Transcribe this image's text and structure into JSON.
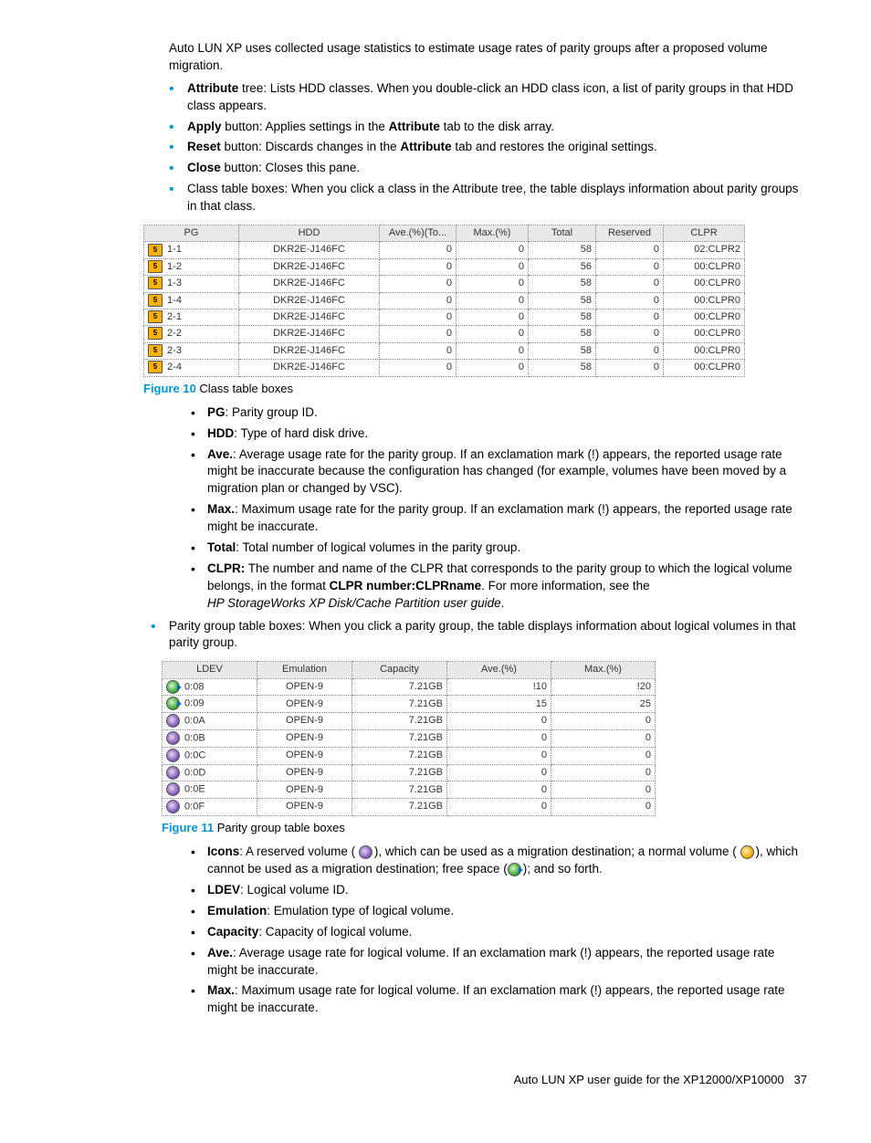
{
  "intro": "Auto LUN XP uses collected usage statistics to estimate usage rates of parity groups after a proposed volume migration.",
  "bullets1": [
    {
      "b": "Attribute",
      "post": " tree: Lists HDD classes. When you double-click an HDD class icon, a list of parity groups in that HDD class appears."
    },
    {
      "b": "Apply",
      "post": " button: Applies settings in the ",
      "b2": "Attribute",
      "post2": " tab to the disk array."
    },
    {
      "b": "Reset",
      "post": " button: Discards changes in the ",
      "b2": "Attribute",
      "post2": " tab and restores the original settings."
    },
    {
      "b": "Close",
      "post": " button: Closes this pane."
    },
    {
      "plain": "Class table boxes: When you click a class in the Attribute tree, the table displays information about parity groups in that class."
    }
  ],
  "table1": {
    "headers": [
      "PG",
      "HDD",
      "Ave.(%)(To...",
      "Max.(%)",
      "Total",
      "Reserved",
      "CLPR"
    ],
    "widths": [
      95,
      145,
      75,
      70,
      65,
      65,
      80
    ],
    "rows": [
      [
        "1-1",
        "DKR2E-J146FC",
        "0",
        "0",
        "58",
        "0",
        "02:CLPR2"
      ],
      [
        "1-2",
        "DKR2E-J146FC",
        "0",
        "0",
        "56",
        "0",
        "00:CLPR0"
      ],
      [
        "1-3",
        "DKR2E-J146FC",
        "0",
        "0",
        "58",
        "0",
        "00:CLPR0"
      ],
      [
        "1-4",
        "DKR2E-J146FC",
        "0",
        "0",
        "58",
        "0",
        "00:CLPR0"
      ],
      [
        "2-1",
        "DKR2E-J146FC",
        "0",
        "0",
        "58",
        "0",
        "00:CLPR0"
      ],
      [
        "2-2",
        "DKR2E-J146FC",
        "0",
        "0",
        "58",
        "0",
        "00:CLPR0"
      ],
      [
        "2-3",
        "DKR2E-J146FC",
        "0",
        "0",
        "58",
        "0",
        "00:CLPR0"
      ],
      [
        "2-4",
        "DKR2E-J146FC",
        "0",
        "0",
        "58",
        "0",
        "00:CLPR0"
      ]
    ]
  },
  "fig10": {
    "label": "Figure 10",
    "text": " Class table boxes"
  },
  "defs1": [
    {
      "b": "PG",
      "t": ": Parity group ID."
    },
    {
      "b": "HDD",
      "t": ": Type of hard disk drive."
    },
    {
      "b": "Ave.",
      "t": ": Average usage rate for the parity group. If an exclamation mark (!) appears, the reported usage rate might be inaccurate because the configuration has changed (for example, volumes have been moved by a migration plan or changed by VSC)."
    },
    {
      "b": "Max.",
      "t": ": Maximum usage rate for the parity group. If an exclamation mark (!) appears, the reported usage rate might be inaccurate."
    },
    {
      "b": "Total",
      "t": ": Total number of logical volumes in the parity group."
    },
    {
      "b": "CLPR:",
      "t": " The number and name of the CLPR that corresponds to the parity group to which the logical volume belongs, in the format ",
      "b2": "CLPR number:CLPRname",
      "t2": ". For more information, see the",
      "it": "HP StorageWorks XP Disk/Cache Partition user guide",
      "t3": "."
    }
  ],
  "bullet2": "Parity group table boxes: When you click a parity group, the table displays information about logical volumes in that parity group.",
  "table2": {
    "headers": [
      "LDEV",
      "Emulation",
      "Capacity",
      "Ave.(%)",
      "Max.(%)"
    ],
    "widths": [
      95,
      95,
      95,
      105,
      105
    ],
    "rows": [
      {
        "icon": "green arrow",
        "ldev": "0:08",
        "emu": "OPEN-9",
        "cap": "7.21GB",
        "ave": "!10",
        "max": "!20"
      },
      {
        "icon": "green arrow",
        "ldev": "0:09",
        "emu": "OPEN-9",
        "cap": "7.21GB",
        "ave": "15",
        "max": "25"
      },
      {
        "icon": "purple",
        "ldev": "0:0A",
        "emu": "OPEN-9",
        "cap": "7.21GB",
        "ave": "0",
        "max": "0"
      },
      {
        "icon": "purple",
        "ldev": "0:0B",
        "emu": "OPEN-9",
        "cap": "7.21GB",
        "ave": "0",
        "max": "0"
      },
      {
        "icon": "purple",
        "ldev": "0:0C",
        "emu": "OPEN-9",
        "cap": "7.21GB",
        "ave": "0",
        "max": "0"
      },
      {
        "icon": "purple",
        "ldev": "0:0D",
        "emu": "OPEN-9",
        "cap": "7.21GB",
        "ave": "0",
        "max": "0"
      },
      {
        "icon": "purple",
        "ldev": "0:0E",
        "emu": "OPEN-9",
        "cap": "7.21GB",
        "ave": "0",
        "max": "0"
      },
      {
        "icon": "purple",
        "ldev": "0:0F",
        "emu": "OPEN-9",
        "cap": "7.21GB",
        "ave": "0",
        "max": "0"
      }
    ]
  },
  "fig11": {
    "label": "Figure 11",
    "text": " Parity group table boxes"
  },
  "defs2": [
    {
      "b": "Icons",
      "t": ": A reserved volume ( ",
      "icon": "purple",
      "t2": "), which can be used as a migration destination; a normal volume ( ",
      "icon2": "yellow",
      "t3": "), which cannot be used as a migration destination; free space (",
      "icon3": "green arrow",
      "t4": "); and so forth."
    },
    {
      "b": "LDEV",
      "t": ": Logical volume ID."
    },
    {
      "b": "Emulation",
      "t": ": Emulation type of logical volume."
    },
    {
      "b": "Capacity",
      "t": ": Capacity of logical volume."
    },
    {
      "b": "Ave.",
      "t": ": Average usage rate for logical volume. If an exclamation mark (!) appears, the reported usage rate might be inaccurate."
    },
    {
      "b": "Max.",
      "t": ": Maximum usage rate for logical volume. If an exclamation mark (!) appears, the reported usage rate might be inaccurate."
    }
  ],
  "footer": {
    "text": "Auto LUN XP user guide for the XP12000/XP10000",
    "page": "37"
  }
}
